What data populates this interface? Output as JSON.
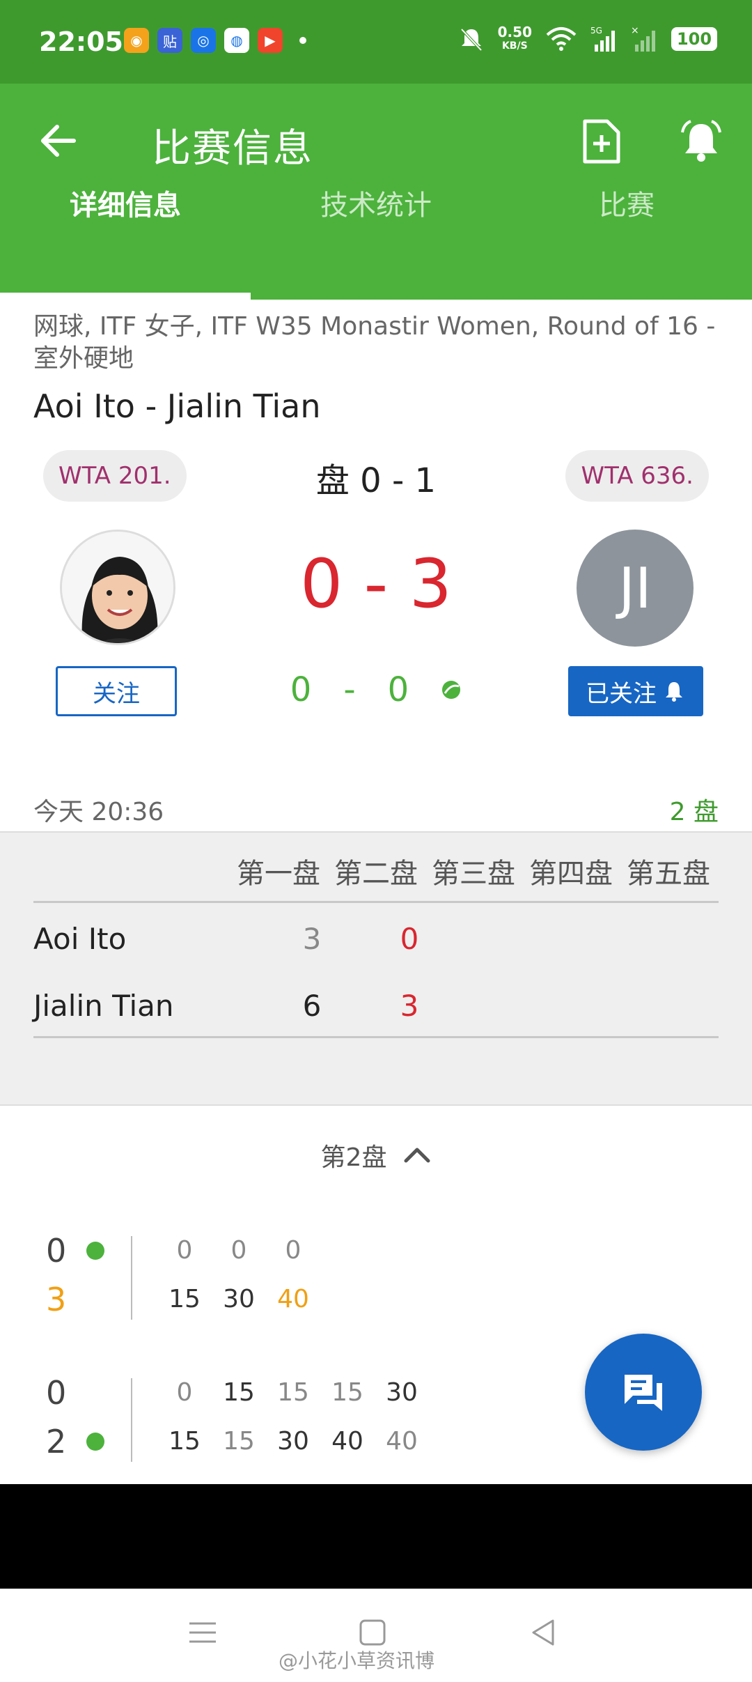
{
  "status_bar": {
    "time": "22:05",
    "net_speed": "0.50",
    "net_unit": "KB/S",
    "battery": "100"
  },
  "app_bar": {
    "title": "比赛信息"
  },
  "tabs": [
    {
      "label": "详细信息",
      "active": true
    },
    {
      "label": "技术统计",
      "active": false
    },
    {
      "label": "比赛",
      "active": false
    }
  ],
  "match": {
    "subtitle": "网球, ITF 女子, ITF W35 Monastir Women, Round of 16 - 室外硬地",
    "name": "Aoi Ito - Jialin Tian",
    "left_rank": "WTA 201.",
    "right_rank": "WTA 636.",
    "sets_score": "盘 0 - 1",
    "game_score": "0 - 3",
    "point_left": "0",
    "point_sep": "-",
    "point_right": "0",
    "right_initials": "JI",
    "follow_label": "关注",
    "followed_label": "已关注",
    "time": "今天 20:36",
    "sets_count": "2 盘"
  },
  "score_table": {
    "headers": [
      "第一盘",
      "第二盘",
      "第三盘",
      "第四盘",
      "第五盘"
    ],
    "rows": [
      {
        "player": "Aoi Ito",
        "set1": "3",
        "set2": "0"
      },
      {
        "player": "Jialin Tian",
        "set1": "6",
        "set2": "3"
      }
    ]
  },
  "set_detail": {
    "label": "第2盘",
    "games": [
      {
        "top_score": "0",
        "bottom_score": "3",
        "top_points": [
          "0",
          "0",
          "0"
        ],
        "bottom_points": [
          "15",
          "30",
          "40"
        ]
      },
      {
        "top_score": "0",
        "bottom_score": "2",
        "top_points": [
          "0",
          "15",
          "15",
          "15",
          "30"
        ],
        "bottom_points": [
          "15",
          "15",
          "30",
          "40",
          "40"
        ]
      }
    ]
  },
  "watermark": "@小花小草资讯博",
  "colors": {
    "brand_green": "#4cb23c",
    "status_green": "#3f9a2e",
    "score_red": "#d9262f",
    "accent_blue": "#1766c4",
    "rank_purple": "#a0306d",
    "highlight_orange": "#f0a015"
  }
}
